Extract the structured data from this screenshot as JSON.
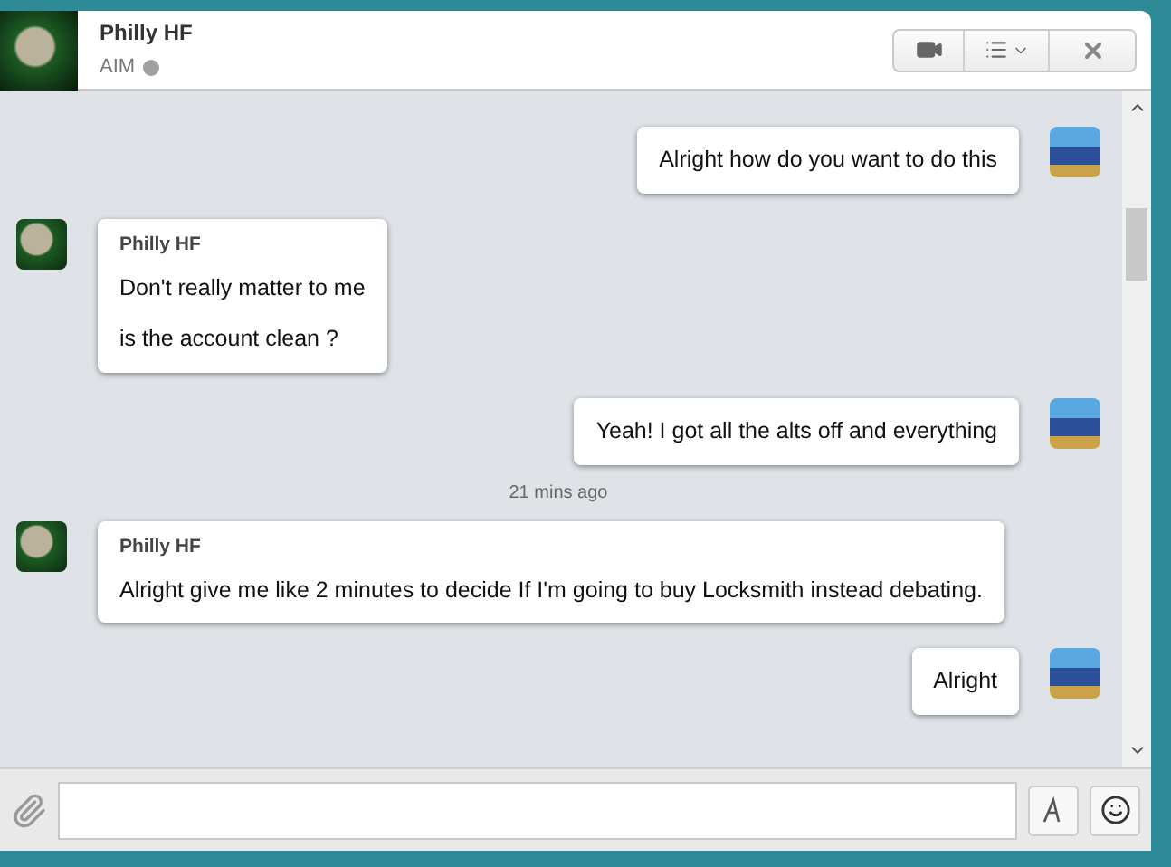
{
  "header": {
    "name": "Philly HF",
    "service": "AIM",
    "online": false
  },
  "messages": [
    {
      "kind": "outgoing",
      "lines": [
        "Alright how do you want to do this"
      ]
    },
    {
      "kind": "incoming",
      "sender": "Philly HF",
      "lines": [
        "Don't really matter to me",
        "is the account clean ?"
      ]
    },
    {
      "kind": "outgoing",
      "lines": [
        "Yeah! I got all the alts off and everything"
      ]
    },
    {
      "kind": "time",
      "text": "21 mins ago"
    },
    {
      "kind": "incoming",
      "sender": "Philly HF",
      "lines": [
        "Alright give me like 2 minutes to decide If I'm going to buy Locksmith instead debating."
      ]
    },
    {
      "kind": "outgoing",
      "lines": [
        "Alright"
      ]
    }
  ]
}
